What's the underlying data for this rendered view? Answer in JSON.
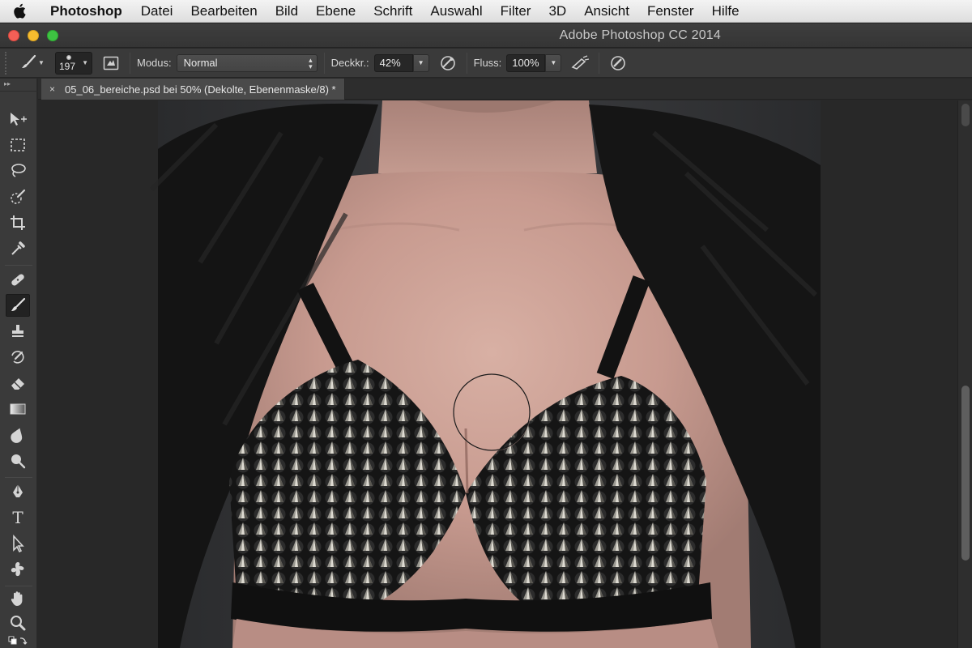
{
  "menubar": {
    "app_name": "Photoshop",
    "items": [
      "Datei",
      "Bearbeiten",
      "Bild",
      "Ebene",
      "Schrift",
      "Auswahl",
      "Filter",
      "3D",
      "Ansicht",
      "Fenster",
      "Hilfe"
    ]
  },
  "window": {
    "title": "Adobe Photoshop CC 2014"
  },
  "options": {
    "brush_size": "197",
    "mode_label": "Modus:",
    "mode_value": "Normal",
    "opacity_label": "Deckkr.:",
    "opacity_value": "42%",
    "flow_label": "Fluss:",
    "flow_value": "100%"
  },
  "document": {
    "tab_close": "×",
    "tab_label": "05_06_bereiche.psd bei 50% (Dekolte, Ebenenmaske/8) *"
  },
  "tools": [
    {
      "name": "move-tool",
      "icon": "move-icon"
    },
    {
      "name": "marquee-tool",
      "icon": "rect-marquee-icon"
    },
    {
      "name": "lasso-tool",
      "icon": "lasso-icon"
    },
    {
      "name": "quick-selection-tool",
      "icon": "quick-select-icon"
    },
    {
      "name": "crop-tool",
      "icon": "crop-icon"
    },
    {
      "name": "eyedropper-tool",
      "icon": "eyedropper-icon"
    },
    {
      "name": "healing-brush-tool",
      "icon": "bandage-icon"
    },
    {
      "name": "brush-tool",
      "icon": "brush-icon",
      "active": true
    },
    {
      "name": "clone-stamp-tool",
      "icon": "stamp-icon"
    },
    {
      "name": "history-brush-tool",
      "icon": "history-brush-icon"
    },
    {
      "name": "eraser-tool",
      "icon": "eraser-icon"
    },
    {
      "name": "gradient-tool",
      "icon": "gradient-icon"
    },
    {
      "name": "blur-tool",
      "icon": "blur-icon"
    },
    {
      "name": "dodge-tool",
      "icon": "dodge-icon"
    },
    {
      "name": "pen-tool",
      "icon": "pen-icon"
    },
    {
      "name": "type-tool",
      "icon": "type-icon"
    },
    {
      "name": "path-selection-tool",
      "icon": "path-select-icon"
    },
    {
      "name": "shape-tool",
      "icon": "custom-shape-icon"
    },
    {
      "name": "hand-tool",
      "icon": "hand-icon"
    },
    {
      "name": "zoom-tool",
      "icon": "zoom-icon"
    }
  ],
  "type_tool_glyph": "T",
  "colors": {
    "chrome": "#3a3a3a",
    "pasteboard": "#282828",
    "active_tool_bg": "#222222"
  }
}
